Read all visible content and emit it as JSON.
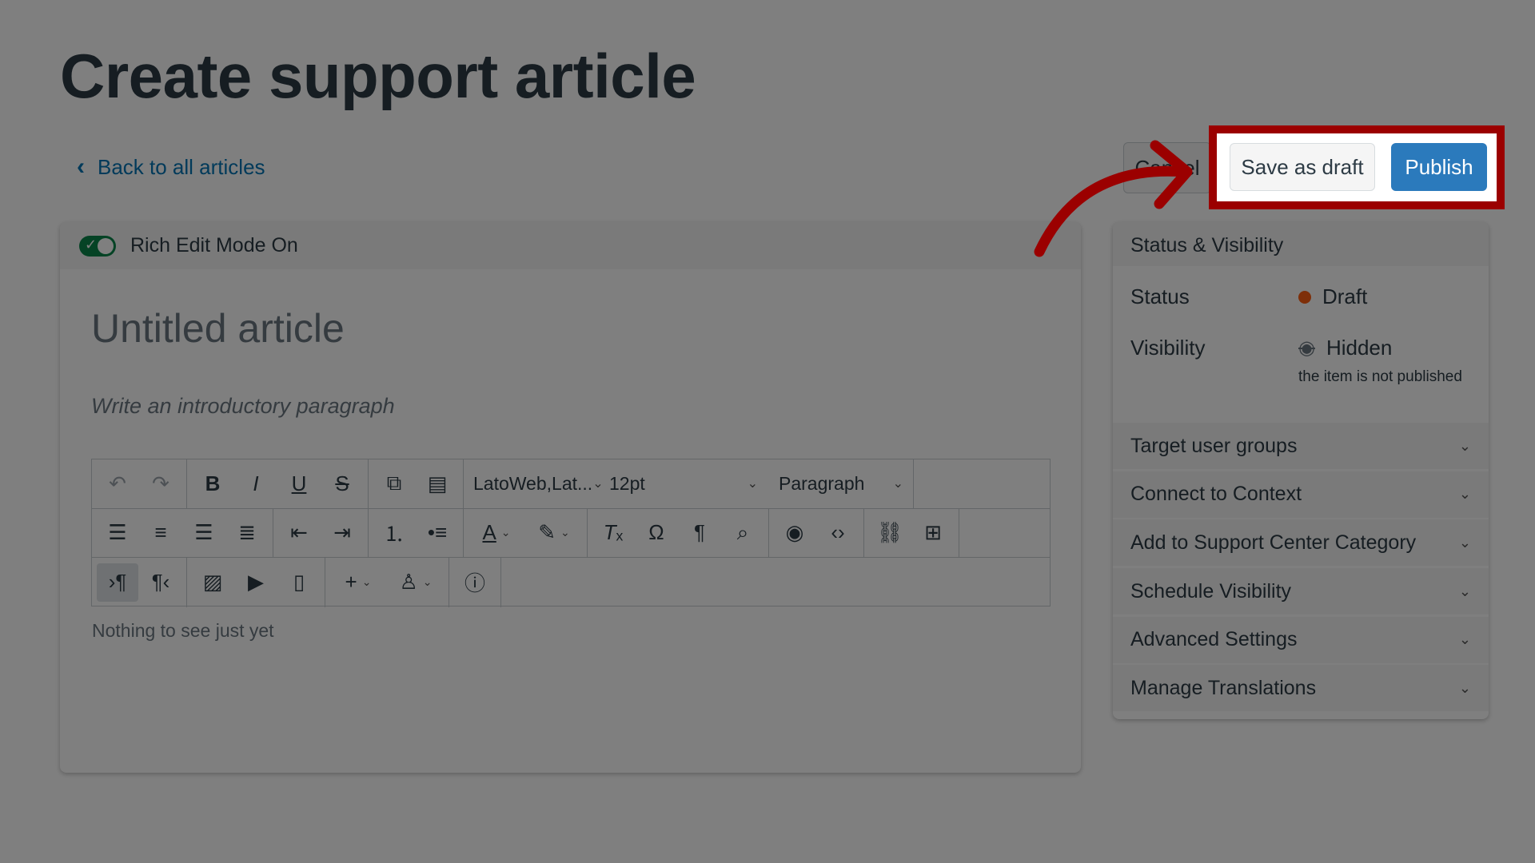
{
  "page": {
    "title": "Create support article",
    "back_link": "Back to all articles"
  },
  "actions": {
    "cancel": "Cancel",
    "save_draft": "Save as draft",
    "publish": "Publish"
  },
  "colors": {
    "highlight": "#9b0000",
    "primary": "#2b7abc",
    "toggle_on": "#0b874b",
    "draft_dot": "#fc5e13"
  },
  "editor": {
    "mode_label": "Rich Edit Mode On",
    "title_placeholder": "Untitled article",
    "intro_placeholder": "Write an introductory paragraph",
    "body_empty": "Nothing to see just yet",
    "font_family": "LatoWeb,Lat...",
    "font_size": "12pt",
    "block_format": "Paragraph",
    "toolbar_icons": {
      "row1": [
        [
          "undo-icon",
          "redo-icon"
        ],
        [
          "bold-icon",
          "italic-icon",
          "underline-icon",
          "strikethrough-icon"
        ],
        [
          "copy-icon",
          "paste-icon"
        ]
      ],
      "row2": [
        [
          "align-left-icon",
          "align-center-icon",
          "align-right-icon",
          "align-justify-icon"
        ],
        [
          "outdent-icon",
          "indent-icon"
        ],
        [
          "ordered-list-icon",
          "bullet-list-icon"
        ],
        [
          "text-color-icon",
          "highlight-color-icon"
        ],
        [
          "clear-formatting-icon",
          "special-character-icon",
          "nonbreaking-space-icon",
          "search-icon"
        ],
        [
          "preview-icon",
          "code-view-icon"
        ],
        [
          "link-icon",
          "table-icon"
        ]
      ],
      "row3": [
        [
          "ltr-icon",
          "rtl-icon"
        ],
        [
          "image-icon",
          "media-icon",
          "document-icon"
        ],
        [
          "insert-plus-icon",
          "embed-icon"
        ],
        [
          "help-icon"
        ]
      ]
    }
  },
  "sidebar": {
    "title": "Status & Visibility",
    "status_label": "Status",
    "status_value": "Draft",
    "visibility_label": "Visibility",
    "visibility_value": "Hidden",
    "visibility_note": "the item is not published",
    "sections": [
      {
        "label": "Target user groups"
      },
      {
        "label": "Connect to Context"
      },
      {
        "label": "Add to Support Center Category"
      },
      {
        "label": "Schedule Visibility"
      },
      {
        "label": "Advanced Settings"
      },
      {
        "label": "Manage Translations"
      }
    ]
  }
}
